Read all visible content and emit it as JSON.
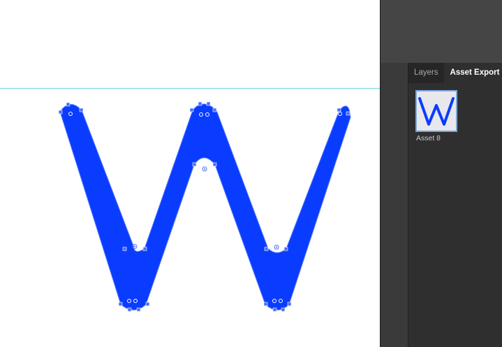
{
  "canvas": {
    "artwork_name": "W letterform",
    "fill_color": "#0a3cff",
    "guide_color": "#6fd3dd"
  },
  "panel": {
    "tabs": [
      {
        "label": "Layers",
        "active": false
      },
      {
        "label": "Asset Export",
        "active": true
      }
    ],
    "assets": [
      {
        "label": "Asset 8",
        "selected": true,
        "thumbnail_letter": "W"
      }
    ]
  }
}
